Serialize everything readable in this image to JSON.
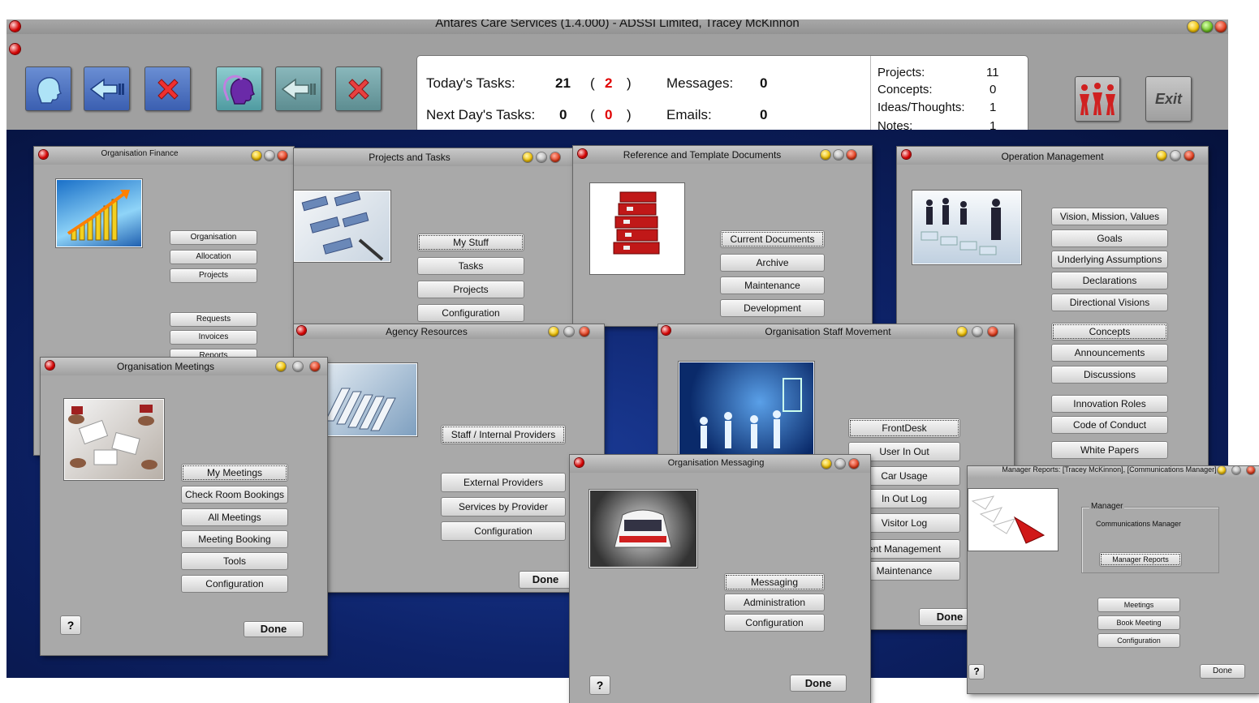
{
  "app": {
    "title": "Antares Care Services (1.4.000) - ADSSI Limited, Tracey McKinnon",
    "exit_label": "Exit"
  },
  "summary": {
    "todays_tasks_label": "Today's Tasks:",
    "todays_tasks": "21",
    "todays_tasks_overdue": "2",
    "next_days_tasks_label": "Next Day's Tasks:",
    "next_days_tasks": "0",
    "next_days_tasks_overdue": "0",
    "messages_label": "Messages:",
    "messages": "0",
    "emails_label": "Emails:",
    "emails": "0",
    "open_paren": "(",
    "close_paren": ")",
    "projects_label": "Projects:",
    "projects": "11",
    "concepts_label": "Concepts:",
    "concepts": "0",
    "ideas_label": "Ideas/Thoughts:",
    "ideas": "1",
    "notes_label": "Notes:",
    "notes": "1"
  },
  "windows": {
    "finance": {
      "title": "Organisation Finance",
      "buttons": [
        "Organisation",
        "Allocation",
        "Projects",
        "Requests",
        "Invoices",
        "Reports"
      ]
    },
    "projects": {
      "title": "Projects and Tasks",
      "buttons": [
        "My Stuff",
        "Tasks",
        "Projects",
        "Configuration"
      ]
    },
    "reference": {
      "title": "Reference and Template Documents",
      "buttons": [
        "Current Documents",
        "Archive",
        "Maintenance",
        "Development"
      ]
    },
    "operation": {
      "title": "Operation Management",
      "buttons": [
        "Vision, Mission, Values",
        "Goals",
        "Underlying Assumptions",
        "Declarations",
        "Directional Visions",
        "Concepts",
        "Announcements",
        "Discussions",
        "Innovation Roles",
        "Code of Conduct",
        "White Papers"
      ]
    },
    "agency": {
      "title": "Agency Resources",
      "buttons": [
        "Staff / Internal Providers",
        "External Providers",
        "Services by Provider",
        "Configuration"
      ],
      "done": "Done"
    },
    "staff": {
      "title": "Organisation Staff Movement",
      "buttons": [
        "FrontDesk",
        "User In Out",
        "Car Usage",
        "In Out Log",
        "Visitor Log",
        "ent Management",
        "Maintenance"
      ],
      "done": "Done"
    },
    "meetings": {
      "title": "Organisation Meetings",
      "buttons": [
        "My Meetings",
        "Check Room Bookings",
        "All Meetings",
        "Meeting Booking",
        "Tools",
        "Configuration"
      ],
      "help": "?",
      "done": "Done"
    },
    "messaging": {
      "title": "Organisation Messaging",
      "buttons": [
        "Messaging",
        "Administration",
        "Configuration"
      ],
      "help": "?",
      "done": "Done"
    },
    "manager": {
      "title": "Manager Reports: [Tracey McKinnon], [Communications Manager]",
      "group_label": "Manager",
      "role": "Communications Manager",
      "report_button": "Manager Reports",
      "buttons": [
        "Meetings",
        "Book Meeting",
        "Configuration"
      ],
      "help": "?",
      "done": "Done"
    }
  },
  "colors": {
    "overdue": "#e00000",
    "desktop": "#0d2268",
    "window": "#a9a9a9"
  },
  "icons": [
    "head-icon",
    "back-arrow-icon",
    "close-x-icon",
    "people-group-icon",
    "exit-icon",
    "help-icon"
  ]
}
